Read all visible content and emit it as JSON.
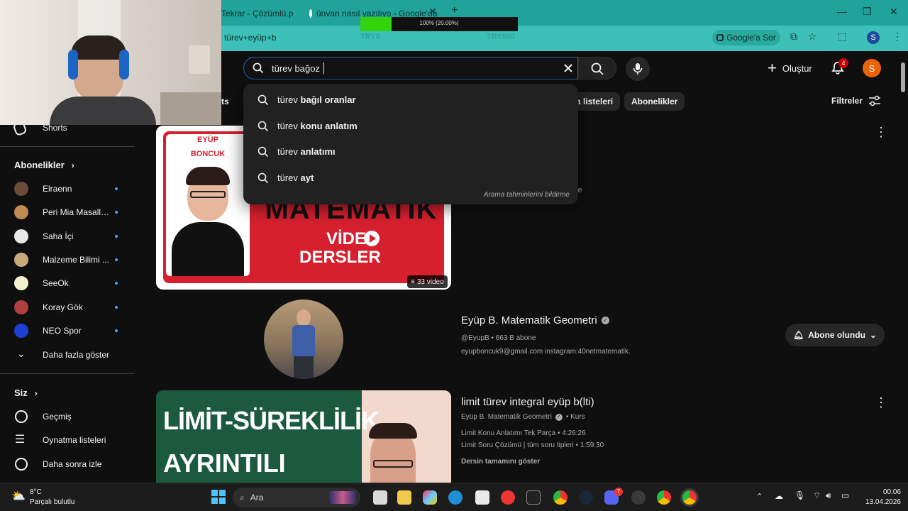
{
  "browser": {
    "tabs": [
      {
        "title": "Tekrar - Çözümlü.p"
      },
      {
        "title": "ünvan nasıl yazılıyo - Google'da Ara"
      }
    ],
    "new_tab_label": "+",
    "url": "türev+eyüp+b",
    "google_sor_label": "Google'a Sor",
    "profile_initial": "S"
  },
  "overlay": {
    "progress_text": "100% (20.00%)",
    "progress_fraction": 0.2,
    "try_left": "TRY0",
    "try_right": "TRY500"
  },
  "header": {
    "search_value": "türev bağoz",
    "create_label": "Oluştur",
    "notification_count": "4",
    "avatar_initial": "S"
  },
  "suggestions": {
    "items": [
      {
        "prefix": "türev ",
        "bold": "bağıl oranlar"
      },
      {
        "prefix": "türev ",
        "bold": "konu anlatım"
      },
      {
        "prefix": "türev ",
        "bold": "anlatımı"
      },
      {
        "prefix": "türev ",
        "bold": "ayt"
      }
    ],
    "report_label": "Arama tahminlerini bildirme"
  },
  "chips": {
    "shorts_partial": "ts",
    "playlists_partial": "a listeleri",
    "subscriptions": "Abonelikler",
    "filters": "Filtreler"
  },
  "sidebar": {
    "shorts": "Shorts",
    "subscriptions_title": "Abonelikler",
    "channels": [
      {
        "name": "Elraenn",
        "color": "#6b4b3a"
      },
      {
        "name": "Peri Mia Masalları",
        "color": "#c08a52"
      },
      {
        "name": "Saha İçi",
        "color": "#e8e8e8"
      },
      {
        "name": "Malzeme Bilimi ...",
        "color": "#c9a97a"
      },
      {
        "name": "SeeOk",
        "color": "#f4f1d0"
      },
      {
        "name": "Koray Gök",
        "color": "#b04040"
      },
      {
        "name": "NEO Spor",
        "color": "#1d3fd8"
      }
    ],
    "show_more": "Daha fazla göster",
    "you_title": "Siz",
    "history": "Geçmiş",
    "playlists": "Oynatma listeleri",
    "watch_later": "Daha sonra izle"
  },
  "results": {
    "playlist_thumb": {
      "brand_top": "EYÜP",
      "brand_bottom": "BONCUK",
      "big_text": "MATEMATİK",
      "video_word": "VİDE",
      "dersler": "DERSLER",
      "count": "33 video",
      "side_letter": "le"
    },
    "channel": {
      "name": "Eyüp B. Matematik Geometri",
      "handle_subs": "@EyupB • 663 B abone",
      "description": "eyupboncuk9@gmail.com instagram:40netmatematik.",
      "subscribed_label": "Abone olundu"
    },
    "course": {
      "thumb_line1": "LİMİT-SÜREKLİLİK",
      "thumb_line2": "AYRINTILI",
      "title": "limit türev integral eyüp b(lti)",
      "channel": "Eyüp B. Matematik Geometri",
      "kind": "• Kurs",
      "line1": "Limit Konu Anlatımı Tek Parça • 4:26:26",
      "line2": "Limit Soru Çözümü | tüm soru tipleri • 1:59:30",
      "show_course": "Dersin tamamını göster"
    }
  },
  "taskbar": {
    "weather_temp": "8°C",
    "weather_desc": "Parçalı bulutlu",
    "search_label": "Ara",
    "time": "00:06",
    "date": "13.04.2026",
    "discord_badge": "7"
  }
}
